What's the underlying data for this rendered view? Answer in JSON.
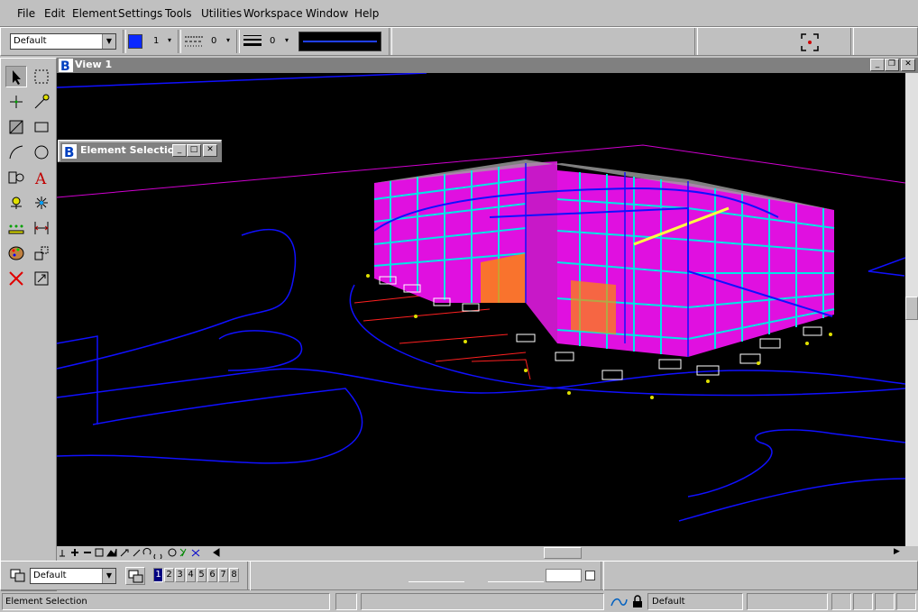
{
  "menu": [
    "File",
    "Edit",
    "Element",
    "Settings",
    "Tools",
    "Utilities",
    "Workspace",
    "Window",
    "Help"
  ],
  "attributes": {
    "level": "Default",
    "color_swatch": "#0a28ff",
    "color_index": "1",
    "style_index": "0",
    "weight_index": "0"
  },
  "view_window": {
    "title": "View 1",
    "bg_color": "#000000"
  },
  "dialog": {
    "title": "Element Selection"
  },
  "view_bar": {
    "level": "Default",
    "views": [
      "1",
      "2",
      "3",
      "4",
      "5",
      "6",
      "7",
      "8"
    ],
    "active_view": "1"
  },
  "status": {
    "message": "Element Selection",
    "active_level": "Default"
  },
  "colors": {
    "selection_blue": "#0000ff",
    "magenta": "#ff00ff",
    "cyan": "#00e6e6",
    "titlebar": "#808080"
  },
  "icons": [
    "element-selection-icon",
    "fence-icon",
    "place-point-icon",
    "smartline-icon",
    "place-block-icon",
    "shape-icon",
    "arc-icon",
    "circle-icon",
    "cell-icon",
    "text-icon",
    "dimension-icon",
    "tag-icon",
    "point-icon",
    "measure-icon",
    "paint-icon",
    "copy-icon",
    "delete-icon",
    "scale-icon"
  ]
}
